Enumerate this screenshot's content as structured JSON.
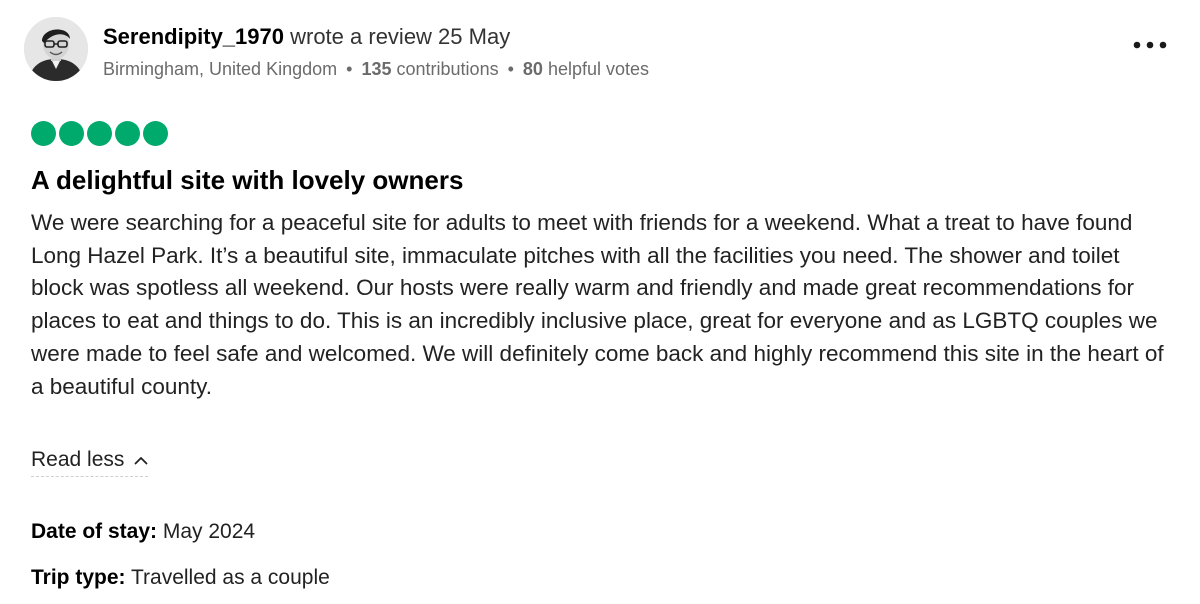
{
  "review": {
    "author": {
      "name": "Serendipity_1970",
      "action": "wrote a review 25 May",
      "location": "Birmingham, United Kingdom",
      "separator": "•",
      "contributions_count": "135",
      "contributions_label": "contributions",
      "helpful_votes_count": "80",
      "helpful_votes_label": "helpful votes"
    },
    "more_menu_icon": "ellipsis-icon",
    "rating": {
      "value": 5,
      "max": 5,
      "color": "#00aa6c"
    },
    "title": "A delightful site with lovely owners",
    "body": "We were searching for a peaceful site for adults to meet with friends for a weekend. What a treat to have found Long Hazel Park. It’s a beautiful site, immaculate pitches with all the facilities you need. The shower and toilet block was spotless all weekend. Our hosts were really warm and friendly and made great recommendations for places to eat and things to do. This is an incredibly inclusive place, great for everyone and as LGBTQ couples we were made to feel safe and welcomed. We will definitely come back and highly recommend this site in the heart of a beautiful county.",
    "read_less_label": "Read less",
    "read_less_icon": "chevron-up-icon",
    "details": {
      "date_of_stay_label": "Date of stay:",
      "date_of_stay_value": "May 2024",
      "trip_type_label": "Trip type:",
      "trip_type_value": "Travelled as a couple"
    }
  }
}
